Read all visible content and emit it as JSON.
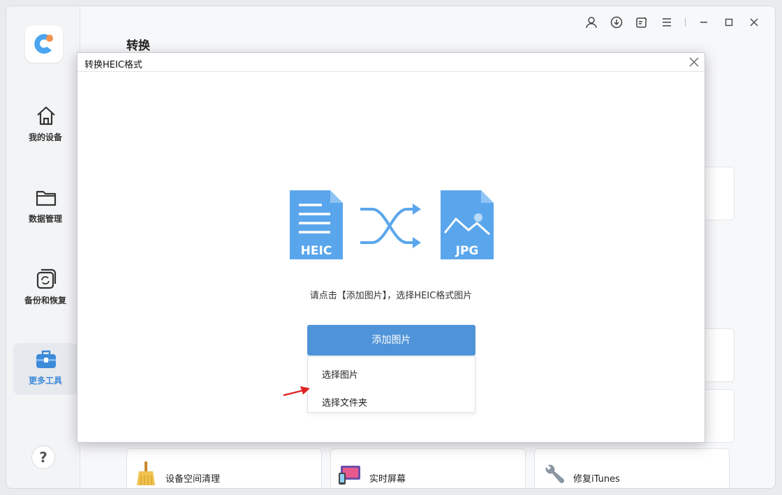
{
  "page": {
    "title": "转换"
  },
  "sidebar": {
    "items": [
      {
        "label": "我的设备",
        "icon": "home-icon"
      },
      {
        "label": "数据管理",
        "icon": "folder-icon"
      },
      {
        "label": "备份和恢复",
        "icon": "backup-icon"
      },
      {
        "label": "更多工具",
        "icon": "toolbox-icon",
        "active": true
      }
    ],
    "help_label": "?"
  },
  "topbar": {
    "icons": [
      "user-icon",
      "download-icon",
      "feedback-icon",
      "menu-icon",
      "minimize-icon",
      "maximize-icon",
      "close-icon"
    ]
  },
  "tools": [
    {
      "label": "设备空间清理",
      "icon": "broom-icon"
    },
    {
      "label": "实时屏幕",
      "icon": "screen-icon"
    },
    {
      "label": "修复iTunes",
      "icon": "wrench-icon"
    }
  ],
  "dialog": {
    "title": "转换HEIC格式",
    "source_format": "HEIC",
    "target_format": "JPG",
    "hint": "请点击【添加图片】，选择HEIC格式图片",
    "add_button": "添加图片",
    "menu": [
      {
        "label": "选择图片"
      },
      {
        "label": "选择文件夹"
      }
    ]
  },
  "colors": {
    "accent": "#4f94d8",
    "icon_blue": "#5aa6ec",
    "arrow_red": "#e02424"
  }
}
